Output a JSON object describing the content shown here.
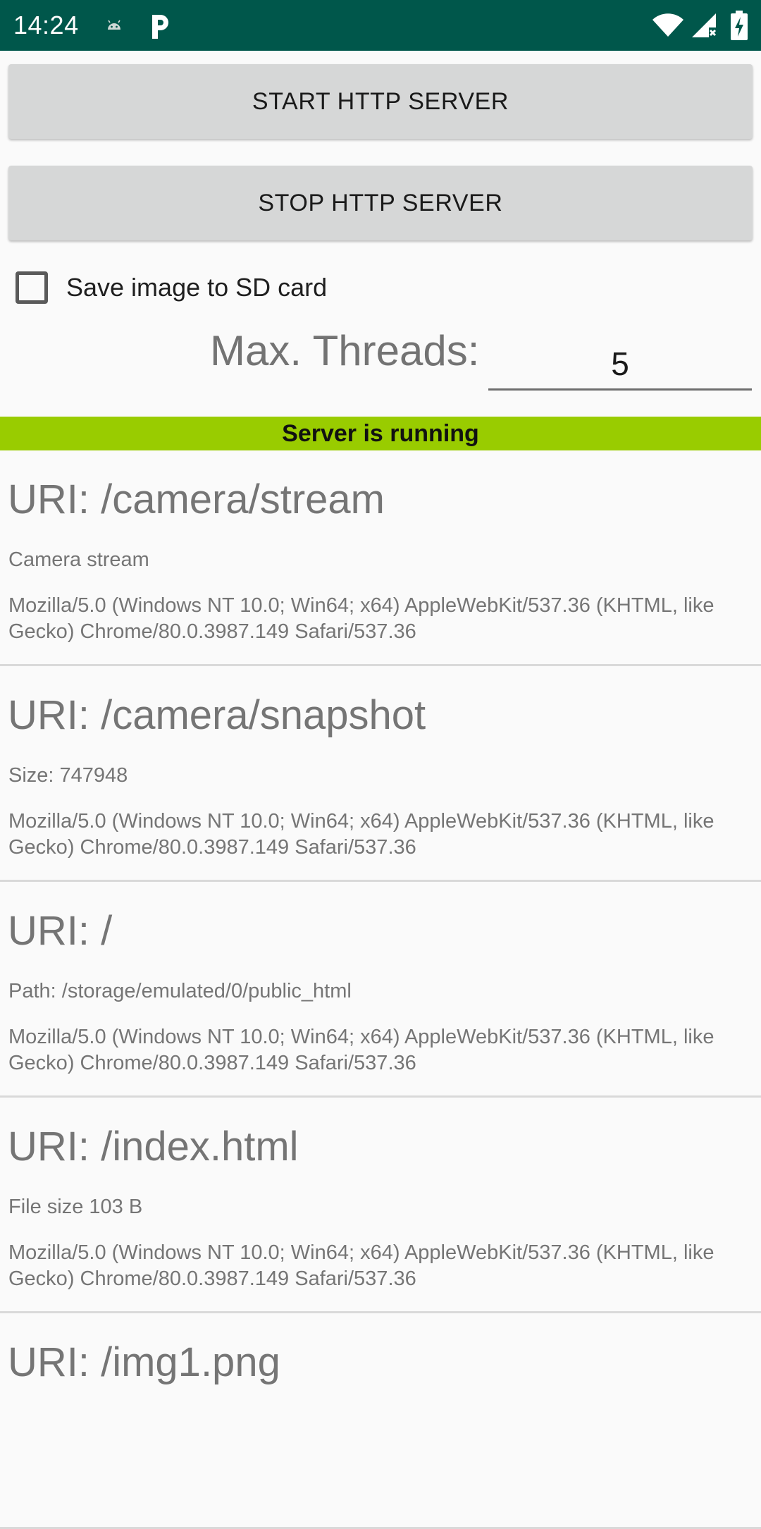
{
  "status_bar": {
    "time": "14:24",
    "icons": [
      "android-notification-icon",
      "p-notification-icon",
      "wifi-icon",
      "signal-icon",
      "battery-charging-icon"
    ],
    "background_color": "#00574b"
  },
  "controls": {
    "start_button": "START HTTP SERVER",
    "stop_button": "STOP HTTP SERVER",
    "save_checkbox_label": "Save image to SD card",
    "save_checkbox_checked": false,
    "max_threads_label": "Max. Threads:",
    "max_threads_value": "5"
  },
  "status": {
    "text": "Server is running",
    "color": "#99cc00"
  },
  "requests": [
    {
      "uri": "URI: /camera/stream",
      "info": "Camera stream",
      "agent": "Mozilla/5.0 (Windows NT 10.0; Win64; x64) AppleWebKit/537.36 (KHTML, like Gecko) Chrome/80.0.3987.149 Safari/537.36"
    },
    {
      "uri": "URI: /camera/snapshot",
      "info": "Size: 747948",
      "agent": "Mozilla/5.0 (Windows NT 10.0; Win64; x64) AppleWebKit/537.36 (KHTML, like Gecko) Chrome/80.0.3987.149 Safari/537.36"
    },
    {
      "uri": "URI: /",
      "info": "Path: /storage/emulated/0/public_html",
      "agent": "Mozilla/5.0 (Windows NT 10.0; Win64; x64) AppleWebKit/537.36 (KHTML, like Gecko) Chrome/80.0.3987.149 Safari/537.36"
    },
    {
      "uri": "URI: /index.html",
      "info": "File size 103 B",
      "agent": "Mozilla/5.0 (Windows NT 10.0; Win64; x64) AppleWebKit/537.36 (KHTML, like Gecko) Chrome/80.0.3987.149 Safari/537.36"
    },
    {
      "uri": "URI: /img1.png",
      "info": "",
      "agent": ""
    }
  ]
}
